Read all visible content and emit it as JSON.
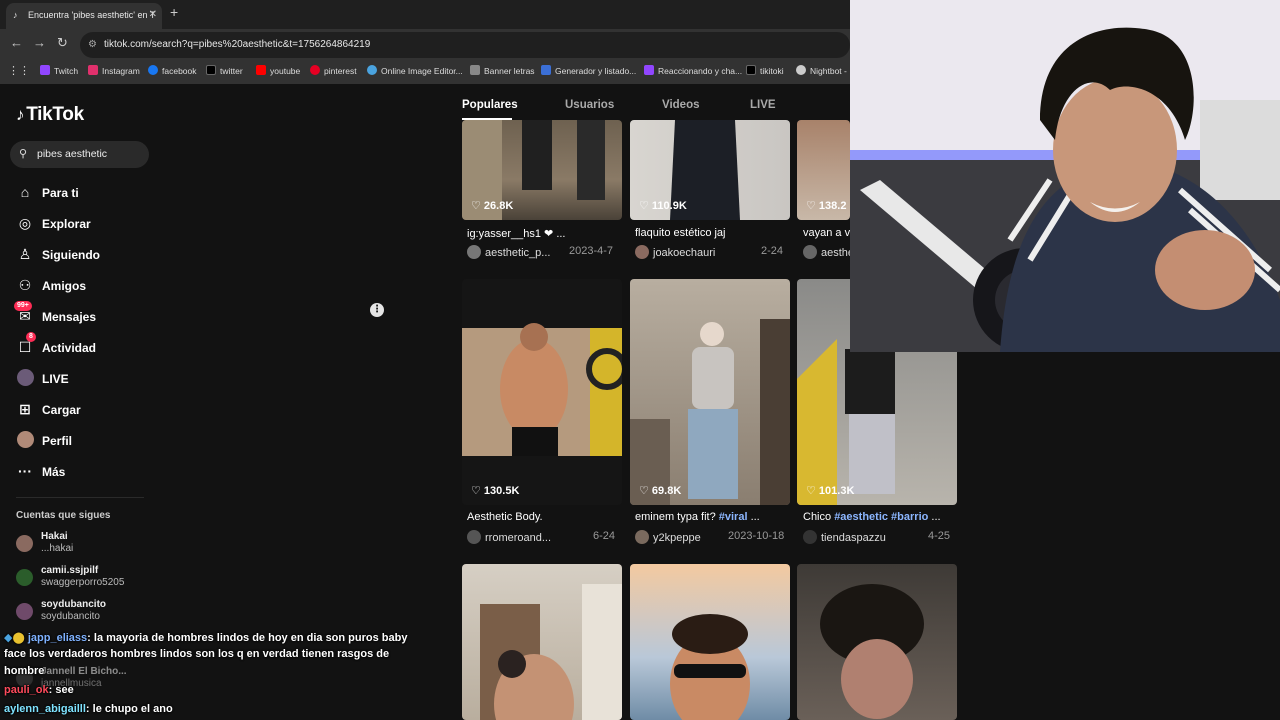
{
  "browser": {
    "tab_title": "Encuentra 'pibes aesthetic' en T",
    "tab_close": "✕",
    "new_tab": "+",
    "url": "tiktok.com/search?q=pibes%20aesthetic&t=1756264864219",
    "bookmarks": [
      {
        "label": "Twitch",
        "icon": "twitch-icon",
        "color": "#9146ff"
      },
      {
        "label": "Instagram",
        "icon": "instagram-icon",
        "color": "#e1306c"
      },
      {
        "label": "facebook",
        "icon": "facebook-icon",
        "color": "#1877f2"
      },
      {
        "label": "twitter",
        "icon": "x-icon",
        "color": "#000000"
      },
      {
        "label": "youtube",
        "icon": "youtube-icon",
        "color": "#ff0000"
      },
      {
        "label": "pinterest",
        "icon": "pinterest-icon",
        "color": "#e60023"
      },
      {
        "label": "Online Image Editor...",
        "icon": "editor-icon",
        "color": "#4aa3df"
      },
      {
        "label": "Banner letras",
        "icon": "banner-icon",
        "color": "#888888"
      },
      {
        "label": "Generador y listado...",
        "icon": "generator-icon",
        "color": "#3b6fd6"
      },
      {
        "label": "Reaccionando y cha...",
        "icon": "twitch-icon",
        "color": "#9146ff"
      },
      {
        "label": "tikitoki",
        "icon": "tiktok-icon",
        "color": "#000000"
      },
      {
        "label": "Nightbot -",
        "icon": "nightbot-icon",
        "color": "#cccccc"
      }
    ]
  },
  "tiktok": {
    "logo": "TikTok",
    "search_value": "pibes aesthetic",
    "menu": [
      {
        "label": "Para ti",
        "icon": "home-icon"
      },
      {
        "label": "Explorar",
        "icon": "compass-icon"
      },
      {
        "label": "Siguiendo",
        "icon": "following-icon"
      },
      {
        "label": "Amigos",
        "icon": "friends-icon"
      },
      {
        "label": "Mensajes",
        "icon": "messages-icon",
        "badge": "99+"
      },
      {
        "label": "Actividad",
        "icon": "activity-icon",
        "badge": "8"
      },
      {
        "label": "LIVE",
        "icon": "live-icon"
      },
      {
        "label": "Cargar",
        "icon": "upload-icon"
      },
      {
        "label": "Perfil",
        "icon": "profile-icon"
      },
      {
        "label": "Más",
        "icon": "more-icon"
      }
    ],
    "following_header": "Cuentas que sigues",
    "following": [
      {
        "name": "Hakai",
        "handle": "...hakai"
      },
      {
        "name": "camii.ssjpilf",
        "handle": "swaggerporro5205"
      },
      {
        "name": "soydubancito",
        "handle": "soydubancito"
      },
      {
        "name": "Jannell El Bicho...",
        "handle": "jannellmusica"
      }
    ],
    "tabs": [
      "Populares",
      "Usuarios",
      "Videos",
      "LIVE"
    ],
    "cards": [
      {
        "likes": "26.8K",
        "caption": "ig:yasser__hs1 ❤ ...",
        "author": "aesthetic_p...",
        "date": "2023-4-7"
      },
      {
        "likes": "110.9K",
        "caption": "flaquito estético jaj",
        "author": "joakoechauri",
        "date": "2-24"
      },
      {
        "likes": "138.2",
        "caption": "vayan a ve",
        "author": "aesthe",
        "date": ""
      },
      {
        "likes": "130.5K",
        "caption": "Aesthetic Body.",
        "author": "rromeroand...",
        "date": "6-24"
      },
      {
        "likes": "69.8K",
        "caption_text": "eminem typa fit? ",
        "caption_tag": "#viral",
        "caption_end": " ...",
        "author": "y2kpeppe",
        "date": "2023-10-18"
      },
      {
        "likes": "101.3K",
        "caption_text": "Chico ",
        "caption_tag": "#aesthetic #barrio",
        "caption_end": " ...",
        "author": "tiendaspazzu",
        "date": "4-25"
      }
    ]
  },
  "chat": [
    {
      "user": "japp_eliass",
      "text": ": la mayoria de hombres lindos de hoy en dia son puros baby"
    },
    {
      "text": "face los verdaderos hombres lindos son los q en verdad tienen rasgos de"
    },
    {
      "text": "hombre"
    },
    {
      "user": "pauli_ok",
      "text": ": see"
    },
    {
      "user": "aylenn_abigailll",
      "text": ": le chupo el ano"
    }
  ]
}
